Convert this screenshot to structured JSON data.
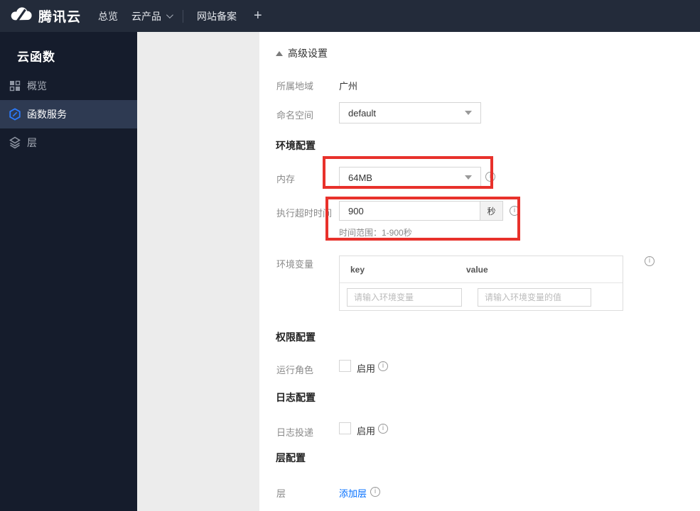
{
  "topbar": {
    "brand": "腾讯云",
    "nav_overview": "总览",
    "nav_products": "云产品",
    "nav_icp": "网站备案",
    "nav_add": "+"
  },
  "sidebar": {
    "title": "云函数",
    "items": [
      {
        "label": "概览",
        "icon": "grid-icon"
      },
      {
        "label": "函数服务",
        "icon": "hexagon-function-icon",
        "active": true
      },
      {
        "label": "层",
        "icon": "layers-icon"
      }
    ]
  },
  "main": {
    "advanced_toggle": "高级设置",
    "region": {
      "label": "所属地域",
      "value": "广州"
    },
    "namespace": {
      "label": "命名空间",
      "value": "default"
    },
    "section_env": "环境配置",
    "memory": {
      "label": "内存",
      "value": "64MB"
    },
    "timeout": {
      "label": "执行超时时间",
      "value": "900",
      "unit": "秒",
      "hint": "时间范围：1-900秒"
    },
    "env_vars": {
      "label": "环境变量",
      "col_key": "key",
      "col_value": "value",
      "key_placeholder": "请输入环境变量",
      "value_placeholder": "请输入环境变量的值"
    },
    "section_perm": "权限配置",
    "run_role": {
      "label": "运行角色",
      "checkbox_label": "启用",
      "checked": false
    },
    "section_log": "日志配置",
    "log_delivery": {
      "label": "日志投递",
      "checkbox_label": "启用",
      "checked": false
    },
    "section_layer": "层配置",
    "layer": {
      "label": "层",
      "link": "添加层"
    }
  },
  "colors": {
    "topbar_bg": "#232b3a",
    "sidebar_bg": "#151c2c",
    "sidebar_active_bg": "#2e3a52",
    "highlight_red": "#e8312b",
    "link_blue": "#006eff",
    "function_icon_blue": "#2b7cff"
  }
}
